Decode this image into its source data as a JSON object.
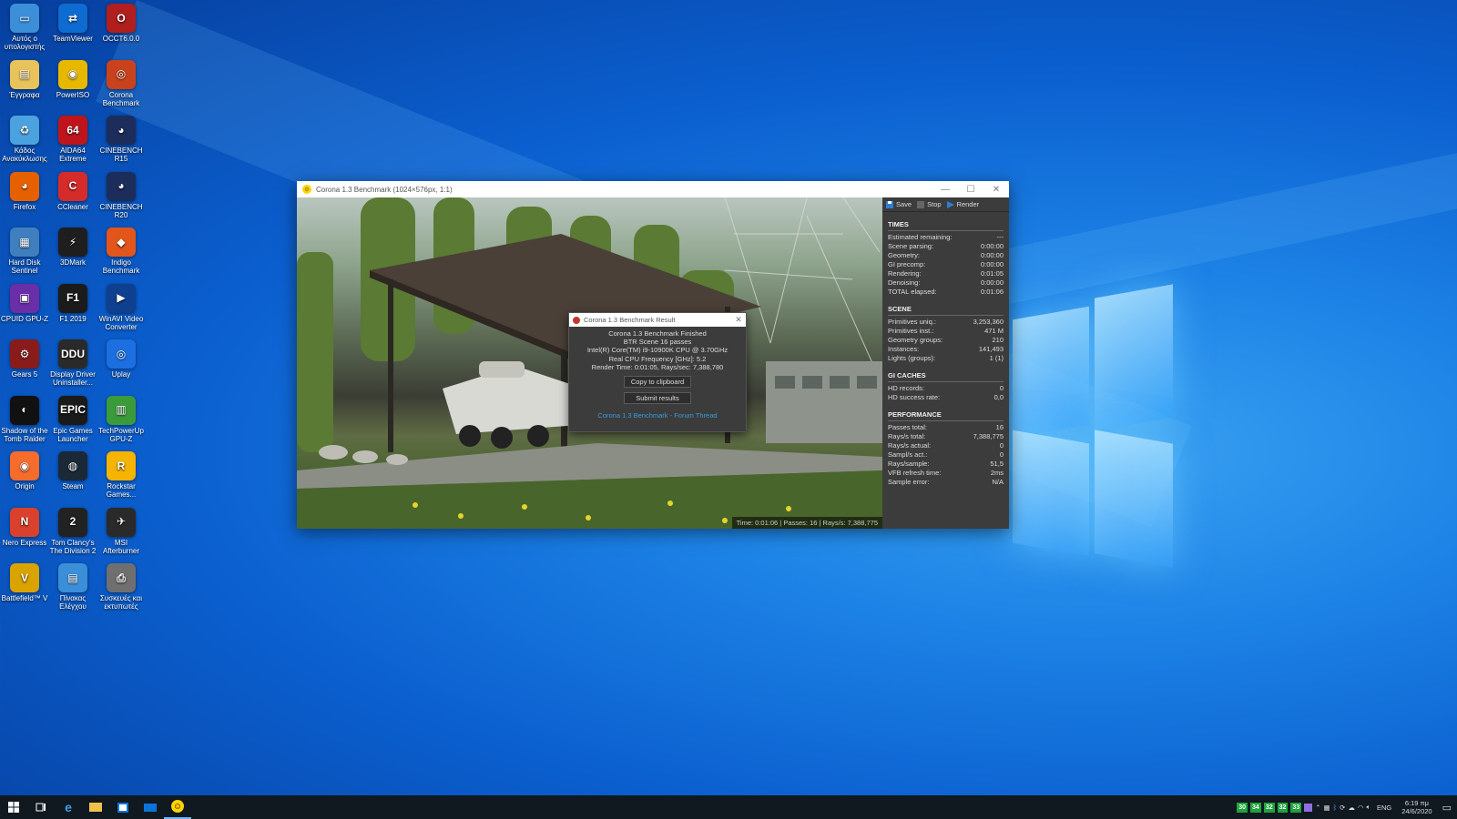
{
  "desktop": {
    "icons": [
      {
        "label": "Αυτός ο υπολογιστής",
        "color": "#3b8fd9",
        "glyph": "▭",
        "icon": "computer-icon"
      },
      {
        "label": "TeamViewer",
        "color": "#0e6bd1",
        "glyph": "⇄",
        "icon": "teamviewer-icon"
      },
      {
        "label": "OCCT6.0.0",
        "color": "#b01e1e",
        "glyph": "O",
        "icon": "occt-icon"
      },
      {
        "label": "Έγγραφα",
        "color": "#e8c25a",
        "glyph": "▤",
        "icon": "documents-icon"
      },
      {
        "label": "PowerISO",
        "color": "#e6b800",
        "glyph": "◉",
        "icon": "poweriso-icon"
      },
      {
        "label": "Corona Benchmark",
        "color": "#c9421e",
        "glyph": "◎",
        "icon": "corona-icon"
      },
      {
        "label": "Κάδος Ανακύκλωσης",
        "color": "#4aa3df",
        "glyph": "♻",
        "icon": "recycle-bin-icon"
      },
      {
        "label": "AIDA64 Extreme",
        "color": "#c0141c",
        "glyph": "64",
        "icon": "aida64-icon"
      },
      {
        "label": "CINEBENCH R15",
        "color": "#1c2d5c",
        "glyph": "◕",
        "icon": "cinebench-icon"
      },
      {
        "label": "Firefox",
        "color": "#e66000",
        "glyph": "◕",
        "icon": "firefox-icon"
      },
      {
        "label": "CCleaner",
        "color": "#d62b2b",
        "glyph": "C",
        "icon": "ccleaner-icon"
      },
      {
        "label": "CINEBENCH R20",
        "color": "#1c2d5c",
        "glyph": "◕",
        "icon": "cinebench-icon"
      },
      {
        "label": "Hard Disk Sentinel",
        "color": "#3f7fbf",
        "glyph": "▦",
        "icon": "hdd-icon"
      },
      {
        "label": "3DMark",
        "color": "#1e1e1e",
        "glyph": "⚡",
        "icon": "3dmark-icon"
      },
      {
        "label": "Indigo Benchmark",
        "color": "#e2561b",
        "glyph": "◆",
        "icon": "indigo-icon"
      },
      {
        "label": "CPUID GPU-Z",
        "color": "#6a2ea8",
        "glyph": "▣",
        "icon": "gpuz-icon"
      },
      {
        "label": "F1 2019",
        "color": "#1b1b1b",
        "glyph": "F1",
        "icon": "f1-icon"
      },
      {
        "label": "WinAVI Video Converter",
        "color": "#0f3f8f",
        "glyph": "▶",
        "icon": "winavi-icon"
      },
      {
        "label": "Gears 5",
        "color": "#8a1b1b",
        "glyph": "⚙",
        "icon": "gears-icon"
      },
      {
        "label": "Display Driver Uninstaller...",
        "color": "#2a2a2a",
        "glyph": "DDU",
        "icon": "ddu-icon"
      },
      {
        "label": "Uplay",
        "color": "#1b6fe0",
        "glyph": "◎",
        "icon": "uplay-icon"
      },
      {
        "label": "Shadow of the Tomb Raider",
        "color": "#111111",
        "glyph": "◐",
        "icon": "tombraider-icon"
      },
      {
        "label": "Epic Games Launcher",
        "color": "#1a1a1a",
        "glyph": "EPIC",
        "icon": "epic-icon"
      },
      {
        "label": "TechPowerUp GPU-Z",
        "color": "#3b9b3b",
        "glyph": "▥",
        "icon": "techpowerup-icon"
      },
      {
        "label": "Origin",
        "color": "#f56c2d",
        "glyph": "◉",
        "icon": "origin-icon"
      },
      {
        "label": "Steam",
        "color": "#1b2838",
        "glyph": "◍",
        "icon": "steam-icon"
      },
      {
        "label": "Rockstar Games...",
        "color": "#f4b400",
        "glyph": "R",
        "icon": "rockstar-icon"
      },
      {
        "label": "Nero Express",
        "color": "#d9412c",
        "glyph": "N",
        "icon": "nero-icon"
      },
      {
        "label": "Tom Clancy's The Division 2",
        "color": "#222222",
        "glyph": "2",
        "icon": "division-icon"
      },
      {
        "label": "MSI Afterburner",
        "color": "#2a2a2a",
        "glyph": "✈",
        "icon": "afterburner-icon"
      },
      {
        "label": "Battlefield™ V",
        "color": "#d9a300",
        "glyph": "V",
        "icon": "battlefield-icon"
      },
      {
        "label": "Πίνακας Ελέγχου",
        "color": "#3b8fd9",
        "glyph": "▤",
        "icon": "control-panel-icon"
      },
      {
        "label": "Συσκευές και εκτυπωτές",
        "color": "#6f6f6f",
        "glyph": "⎙",
        "icon": "printer-icon"
      }
    ]
  },
  "window": {
    "title": "Corona 1.3 Benchmark (1024×576px, 1:1)",
    "status": "Time: 0:01:06 | Passes: 16 | Rays/s: 7,388,775",
    "toolbar": {
      "save": "Save",
      "stop": "Stop",
      "render": "Render"
    },
    "sections": [
      {
        "title": "TIMES",
        "rows": [
          [
            "Estimated remaining:",
            "---"
          ],
          [
            "Scene parsing:",
            "0:00:00"
          ],
          [
            "Geometry:",
            "0:00:00"
          ],
          [
            "GI precomp:",
            "0:00:00"
          ],
          [
            "Rendering:",
            "0:01:05"
          ],
          [
            "Denoising:",
            "0:00:00"
          ],
          [
            "TOTAL elapsed:",
            "0:01:06"
          ]
        ]
      },
      {
        "title": "SCENE",
        "rows": [
          [
            "Primitives uniq.:",
            "3,253,360"
          ],
          [
            "Primitives inst.:",
            "471 M"
          ],
          [
            "Geometry groups:",
            "210"
          ],
          [
            "Instances:",
            "141,493"
          ],
          [
            "Lights (groups):",
            "1 (1)"
          ]
        ]
      },
      {
        "title": "GI CACHES",
        "rows": [
          [
            "HD records:",
            "0"
          ],
          [
            "HD success rate:",
            "0,0"
          ]
        ]
      },
      {
        "title": "PERFORMANCE",
        "rows": [
          [
            "Passes total:",
            "16"
          ],
          [
            "Rays/s total:",
            "7,388,775"
          ],
          [
            "Rays/s actual:",
            "0"
          ],
          [
            "Sampl/s act.:",
            "0"
          ],
          [
            "Rays/sample:",
            "51,5"
          ],
          [
            "VFB refresh time:",
            "2ms"
          ],
          [
            "Sample error:",
            "N/A"
          ]
        ]
      }
    ]
  },
  "dialog": {
    "title": "Corona 1.3 Benchmark Result",
    "lines": [
      "Corona 1.3 Benchmark Finished",
      "BTR Scene 16 passes",
      "Intel(R) Core(TM) i9-10900K CPU @ 3.70GHz",
      "Real CPU Frequency [GHz]: 5.2",
      "Render Time: 0:01:05, Rays/sec: 7,388,780"
    ],
    "copy_button": "Copy to clipboard",
    "submit_button": "Submit results",
    "forum_link": "Corona 1.3 Benchmark - Forum Thread"
  },
  "taskbar": {
    "temps": [
      "30",
      "34",
      "32",
      "32",
      "33"
    ],
    "language": "ENG",
    "time": "6:19 πμ",
    "date": "24/6/2020"
  }
}
